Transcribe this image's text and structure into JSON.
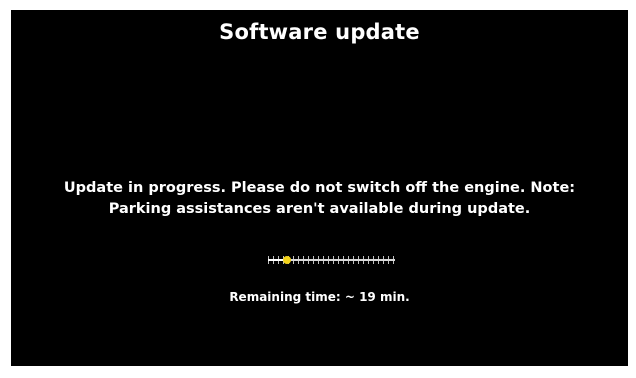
{
  "screen": {
    "title": "Software update",
    "message_lines": [
      "Update in progress. Please do not switch off the engine. Note:",
      "Parking assistances aren't available during update."
    ],
    "progress": {
      "fraction": 0.15,
      "knob_color": "#f2d21a"
    },
    "remaining_label": "Remaining time: ~ 19 min."
  }
}
